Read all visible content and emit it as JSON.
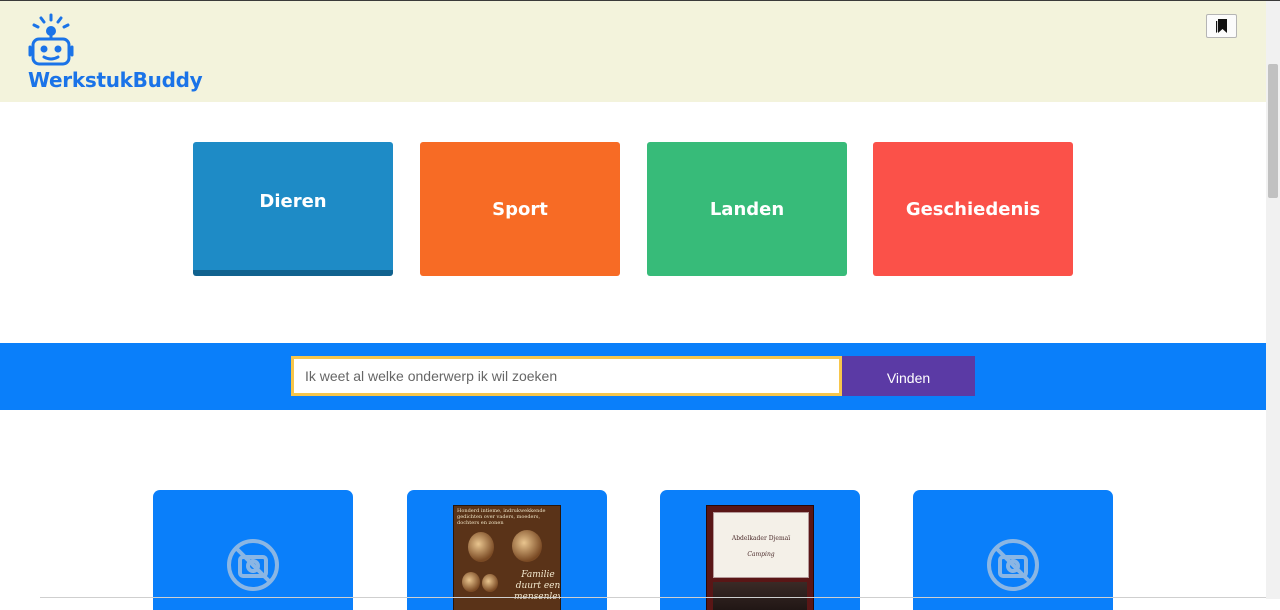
{
  "header": {
    "brand": "WerkstukBuddy",
    "logo_icon": "robot-icon",
    "bookmark_icon": "bookmark-icon"
  },
  "categories": [
    {
      "label": "Dieren",
      "color": "#1e8bc6"
    },
    {
      "label": "Sport",
      "color": "#f76b25"
    },
    {
      "label": "Landen",
      "color": "#37bb79"
    },
    {
      "label": "Geschiedenis",
      "color": "#fb5149"
    }
  ],
  "search": {
    "placeholder": "Ik weet al welke onderwerp ik wil zoeken",
    "value": "",
    "button_label": "Vinden"
  },
  "cards": [
    {
      "image": "no-image-icon"
    },
    {
      "image": "book-cover",
      "cover_top_text": "Honderd intieme, indrukwekkende gedichten over vaders, moeders, dochters en zonen",
      "cover_title": "Familie duurt een mensenleven"
    },
    {
      "image": "book-cover",
      "cover_author": "Abdelkader Djemaï",
      "cover_title": "Camping"
    },
    {
      "image": "no-image-icon"
    }
  ],
  "colors": {
    "header_bg": "#f3f3dc",
    "brand_blue": "#1a73e8",
    "search_band": "#0a7ffa",
    "search_border": "#f7c64b",
    "search_button": "#5b3aa5",
    "card_bg": "#0a7ffa"
  }
}
